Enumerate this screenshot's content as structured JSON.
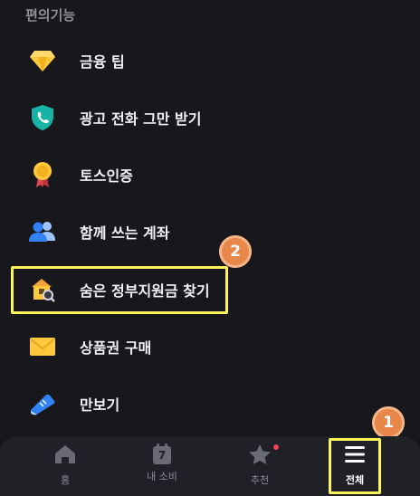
{
  "section": {
    "title": "편의기능"
  },
  "menu": [
    {
      "label": "금융 팁",
      "icon": "diamond-icon"
    },
    {
      "label": "광고 전화 그만 받기",
      "icon": "shield-phone-icon"
    },
    {
      "label": "토스인증",
      "icon": "medal-icon"
    },
    {
      "label": "함께 쓰는 계좌",
      "icon": "people-icon"
    },
    {
      "label": "숨은 정부지원금 찾기",
      "icon": "house-search-icon"
    },
    {
      "label": "상품권 구매",
      "icon": "envelope-icon"
    },
    {
      "label": "만보기",
      "icon": "sneaker-icon"
    }
  ],
  "badges": {
    "step1": "1",
    "step2": "2"
  },
  "tabs": [
    {
      "label": "홈",
      "icon": "home-icon"
    },
    {
      "label": "내 소비",
      "icon": "calendar-icon",
      "icon_text": "7"
    },
    {
      "label": "추천",
      "icon": "star-icon"
    },
    {
      "label": "전체",
      "icon": "menu-icon"
    }
  ],
  "colors": {
    "background": "#17171c",
    "highlight": "#fff45c",
    "badge": "#e8874a",
    "notification_dot": "#f04452"
  }
}
